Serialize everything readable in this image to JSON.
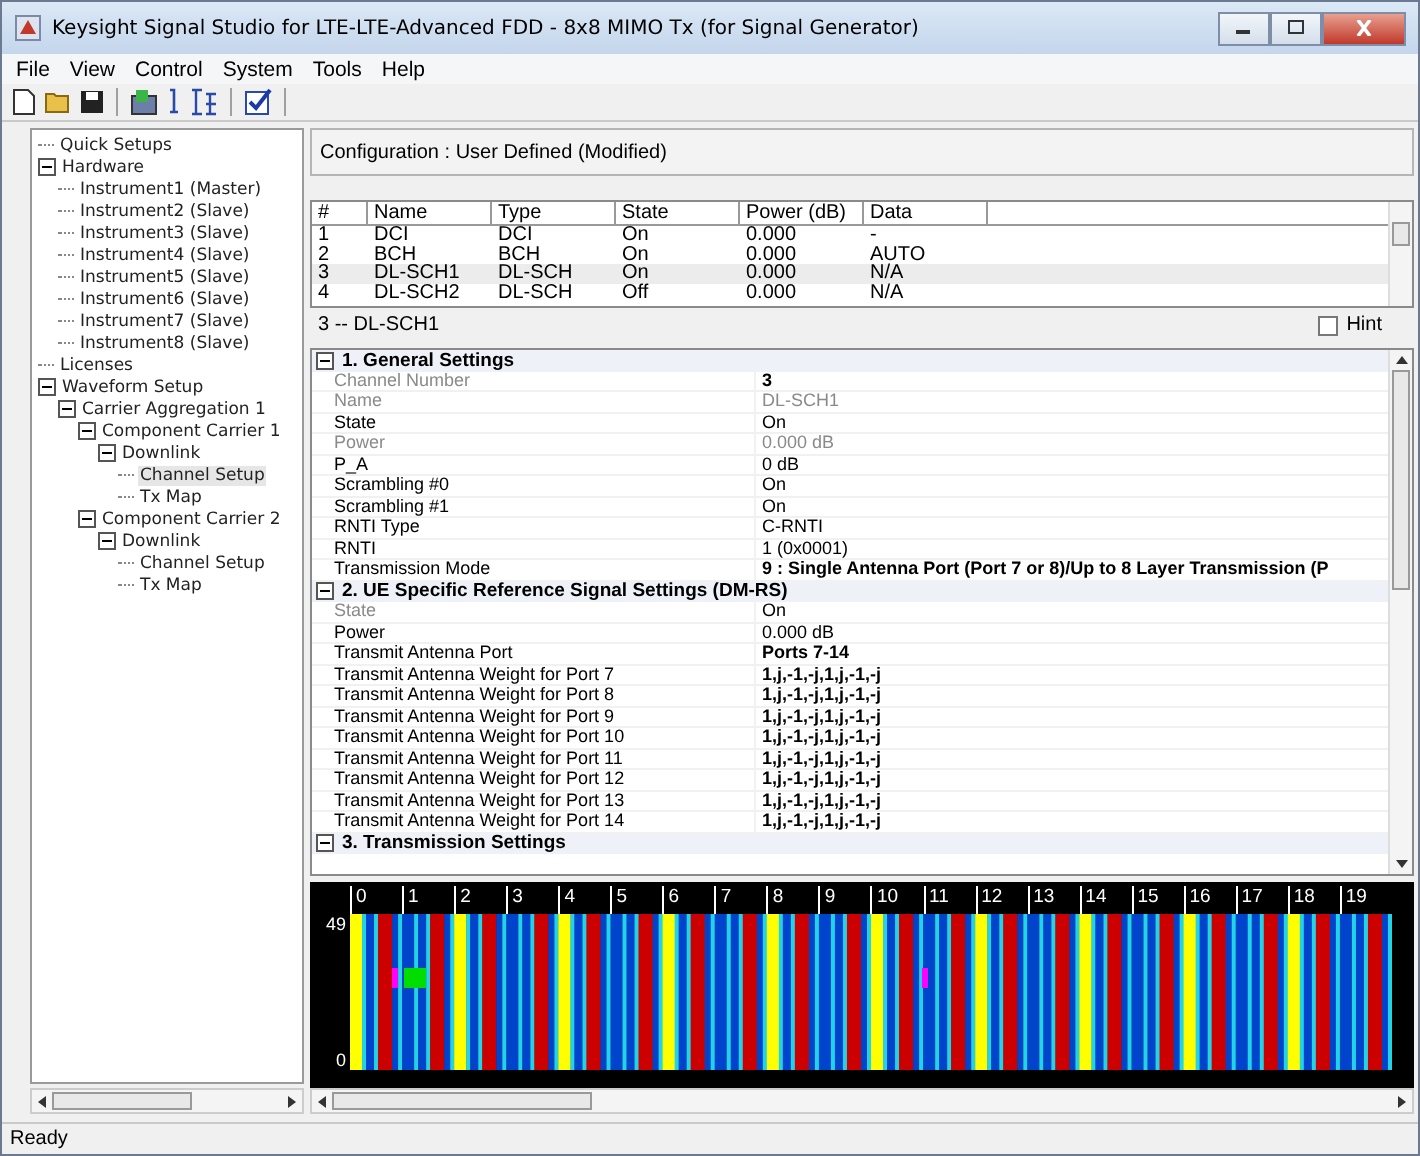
{
  "window": {
    "title": "Keysight Signal Studio for LTE-LTE-Advanced FDD - 8x8 MIMO Tx (for Signal Generator)"
  },
  "menu": [
    "File",
    "View",
    "Control",
    "System",
    "Tools",
    "Help"
  ],
  "tree": [
    {
      "label": "Quick Setups",
      "selected": false
    },
    {
      "label": "Hardware",
      "selected": false,
      "expanded": true,
      "children": [
        {
          "label": "Instrument1 (Master)",
          "selected": false
        },
        {
          "label": "Instrument2 (Slave)",
          "selected": false
        },
        {
          "label": "Instrument3 (Slave)",
          "selected": false
        },
        {
          "label": "Instrument4 (Slave)",
          "selected": false
        },
        {
          "label": "Instrument5 (Slave)",
          "selected": false
        },
        {
          "label": "Instrument6 (Slave)",
          "selected": false
        },
        {
          "label": "Instrument7 (Slave)",
          "selected": false
        },
        {
          "label": "Instrument8 (Slave)",
          "selected": false
        }
      ]
    },
    {
      "label": "Licenses",
      "selected": false
    },
    {
      "label": "Waveform Setup",
      "selected": false,
      "expanded": true,
      "children": [
        {
          "label": "Carrier Aggregation 1",
          "selected": false,
          "expanded": true,
          "children": [
            {
              "label": "Component Carrier 1",
              "selected": false,
              "expanded": true,
              "children": [
                {
                  "label": "Downlink",
                  "selected": false,
                  "expanded": true,
                  "children": [
                    {
                      "label": "Channel Setup",
                      "selected": true
                    },
                    {
                      "label": "Tx Map",
                      "selected": false
                    }
                  ]
                }
              ]
            },
            {
              "label": "Component Carrier 2",
              "selected": false,
              "expanded": true,
              "children": [
                {
                  "label": "Downlink",
                  "selected": false,
                  "expanded": true,
                  "children": [
                    {
                      "label": "Channel Setup",
                      "selected": false
                    },
                    {
                      "label": "Tx Map",
                      "selected": false
                    }
                  ]
                }
              ]
            }
          ]
        }
      ]
    }
  ],
  "configuration": "Configuration : User Defined (Modified)",
  "channel_table": {
    "columns": [
      "#",
      "Name",
      "Type",
      "State",
      "Power (dB)",
      "Data"
    ],
    "rows": [
      {
        "cells": [
          "1",
          "DCI",
          "DCI",
          "On",
          "0.000",
          "-"
        ],
        "selected": false
      },
      {
        "cells": [
          "2",
          "BCH",
          "BCH",
          "On",
          "0.000",
          "AUTO"
        ],
        "selected": false
      },
      {
        "cells": [
          "3",
          "DL-SCH1",
          "DL-SCH",
          "On",
          "0.000",
          "N/A"
        ],
        "selected": true
      },
      {
        "cells": [
          "4",
          "DL-SCH2",
          "DL-SCH",
          "Off",
          "0.000",
          "N/A"
        ],
        "selected": false
      }
    ]
  },
  "selection_label": "3 -- DL-SCH1",
  "hint": {
    "label": "Hint",
    "checked": false
  },
  "properties": [
    {
      "title": "1. General Settings",
      "expanded": true,
      "rows": [
        {
          "label": "Channel Number",
          "value": "3",
          "label_disabled": true,
          "value_disabled": false,
          "bold": true
        },
        {
          "label": "Name",
          "value": "DL-SCH1",
          "label_disabled": true,
          "value_disabled": true,
          "bold": false
        },
        {
          "label": "State",
          "value": "On",
          "label_disabled": false,
          "value_disabled": false,
          "bold": false
        },
        {
          "label": "Power",
          "value": "0.000 dB",
          "label_disabled": true,
          "value_disabled": true,
          "bold": false
        },
        {
          "label": "P_A",
          "value": "0 dB",
          "label_disabled": false,
          "value_disabled": false,
          "bold": false
        },
        {
          "label": "Scrambling #0",
          "value": "On",
          "label_disabled": false,
          "value_disabled": false,
          "bold": false
        },
        {
          "label": "Scrambling #1",
          "value": "On",
          "label_disabled": false,
          "value_disabled": false,
          "bold": false
        },
        {
          "label": "RNTI Type",
          "value": "C-RNTI",
          "label_disabled": false,
          "value_disabled": false,
          "bold": false
        },
        {
          "label": "RNTI",
          "value": "1 (0x0001)",
          "label_disabled": false,
          "value_disabled": false,
          "bold": false
        },
        {
          "label": "Transmission Mode",
          "value": "9 : Single Antenna Port (Port 7 or 8)/Up to 8 Layer Transmission (P",
          "label_disabled": false,
          "value_disabled": false,
          "bold": true
        }
      ]
    },
    {
      "title": "2. UE Specific Reference Signal Settings (DM-RS)",
      "expanded": true,
      "rows": [
        {
          "label": "State",
          "value": "On",
          "label_disabled": true,
          "value_disabled": false,
          "bold": false
        },
        {
          "label": "Power",
          "value": "0.000 dB",
          "label_disabled": false,
          "value_disabled": false,
          "bold": false
        },
        {
          "label": "Transmit Antenna Port",
          "value": "Ports 7-14",
          "label_disabled": false,
          "value_disabled": false,
          "bold": true
        },
        {
          "label": "Transmit Antenna Weight for Port 7",
          "value": "1,j,-1,-j,1,j,-1,-j",
          "label_disabled": false,
          "value_disabled": false,
          "bold": true
        },
        {
          "label": "Transmit Antenna Weight for Port 8",
          "value": "1,j,-1,-j,1,j,-1,-j",
          "label_disabled": false,
          "value_disabled": false,
          "bold": true
        },
        {
          "label": "Transmit Antenna Weight for Port 9",
          "value": "1,j,-1,-j,1,j,-1,-j",
          "label_disabled": false,
          "value_disabled": false,
          "bold": true
        },
        {
          "label": "Transmit Antenna Weight for Port 10",
          "value": "1,j,-1,-j,1,j,-1,-j",
          "label_disabled": false,
          "value_disabled": false,
          "bold": true
        },
        {
          "label": "Transmit Antenna Weight for Port 11",
          "value": "1,j,-1,-j,1,j,-1,-j",
          "label_disabled": false,
          "value_disabled": false,
          "bold": true
        },
        {
          "label": "Transmit Antenna Weight for Port 12",
          "value": "1,j,-1,-j,1,j,-1,-j",
          "label_disabled": false,
          "value_disabled": false,
          "bold": true
        },
        {
          "label": "Transmit Antenna Weight for Port 13",
          "value": "1,j,-1,-j,1,j,-1,-j",
          "label_disabled": false,
          "value_disabled": false,
          "bold": true
        },
        {
          "label": "Transmit Antenna Weight for Port 14",
          "value": "1,j,-1,-j,1,j,-1,-j",
          "label_disabled": false,
          "value_disabled": false,
          "bold": true
        }
      ]
    },
    {
      "title": "3. Transmission Settings",
      "expanded": true
    }
  ],
  "resource_map": {
    "slot_labels": [
      "0",
      "1",
      "2",
      "3",
      "4",
      "5",
      "6",
      "7",
      "8",
      "9",
      "10",
      "11",
      "12",
      "13",
      "14",
      "15",
      "16",
      "17",
      "18",
      "19"
    ],
    "y_labels": [
      "49",
      "0"
    ]
  },
  "status_bar": "Ready"
}
